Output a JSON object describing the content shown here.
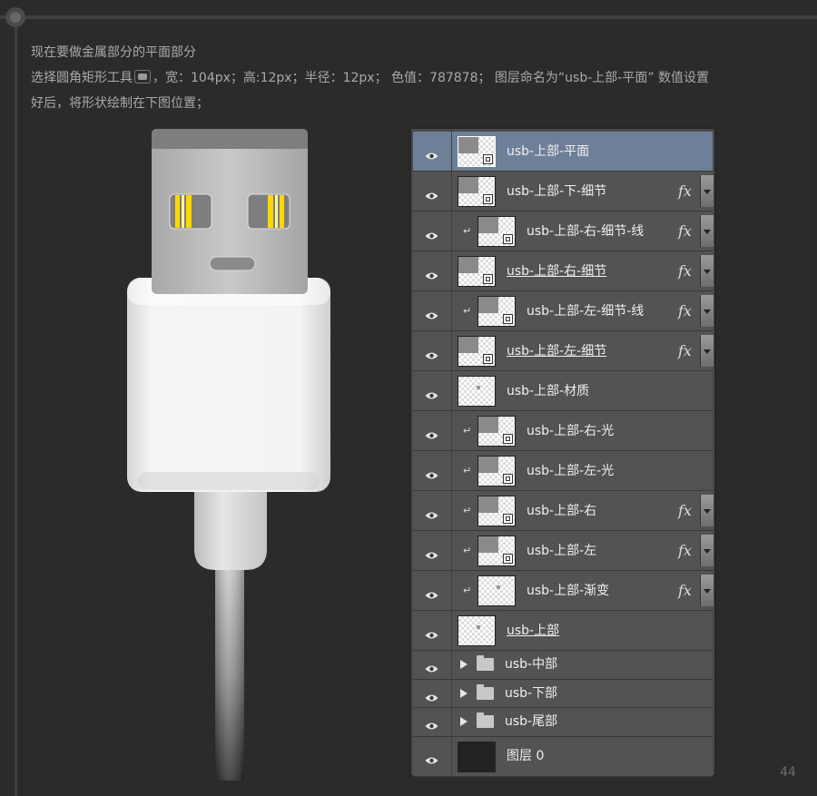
{
  "instructions": {
    "line1": "现在要做金属部分的平面部分",
    "line2_before_icon": "选择圆角矩形工具",
    "line2_after_icon": "，宽：104px；高:12px；半径：12px； 色值：787878； 图层命名为“usb-上部-平面” 数值设置",
    "line3": "好后，将形状绘制在下图位置；",
    "tool_icon": "rounded-rectangle-tool-icon"
  },
  "layers": [
    {
      "name": "usb-上部-平面",
      "selected": true,
      "clipped": false,
      "fx": false,
      "underline": false,
      "thumb": "shape"
    },
    {
      "name": "usb-上部-下-细节",
      "selected": false,
      "clipped": false,
      "fx": true,
      "underline": false,
      "thumb": "shape"
    },
    {
      "name": "usb-上部-右-细节-线",
      "selected": false,
      "clipped": true,
      "fx": true,
      "underline": false,
      "thumb": "shape"
    },
    {
      "name": "usb-上部-右-细节",
      "selected": false,
      "clipped": false,
      "fx": true,
      "underline": true,
      "thumb": "shape"
    },
    {
      "name": "usb-上部-左-细节-线",
      "selected": false,
      "clipped": true,
      "fx": true,
      "underline": false,
      "thumb": "shape"
    },
    {
      "name": "usb-上部-左-细节",
      "selected": false,
      "clipped": false,
      "fx": true,
      "underline": true,
      "thumb": "shape"
    },
    {
      "name": "usb-上部-材质",
      "selected": false,
      "clipped": false,
      "fx": false,
      "underline": false,
      "thumb": "pixel"
    },
    {
      "name": "usb-上部-右-光",
      "selected": false,
      "clipped": true,
      "fx": false,
      "underline": false,
      "thumb": "shape"
    },
    {
      "name": "usb-上部-左-光",
      "selected": false,
      "clipped": true,
      "fx": false,
      "underline": false,
      "thumb": "shape"
    },
    {
      "name": "usb-上部-右",
      "selected": false,
      "clipped": true,
      "fx": true,
      "underline": false,
      "thumb": "shape"
    },
    {
      "name": "usb-上部-左",
      "selected": false,
      "clipped": true,
      "fx": true,
      "underline": false,
      "thumb": "shape"
    },
    {
      "name": "usb-上部-渐变",
      "selected": false,
      "clipped": true,
      "fx": true,
      "underline": false,
      "thumb": "pixel"
    },
    {
      "name": "usb-上部",
      "selected": false,
      "clipped": false,
      "fx": false,
      "underline": true,
      "thumb": "pixel"
    }
  ],
  "groups": [
    {
      "name": "usb-中部"
    },
    {
      "name": "usb-下部"
    },
    {
      "name": "usb-尾部"
    }
  ],
  "background_layer": {
    "name": "图层 0"
  },
  "icons": {
    "visibility": "eye-icon",
    "effects": "fx-icon",
    "clip": "clipping-mask-icon",
    "group": "folder-icon"
  },
  "fx_label": "fx",
  "clip_glyph": "↵",
  "page_number": "44",
  "colors": {
    "selected_row": "#6e7f98",
    "row": "#535353",
    "background": "#2b2b2b"
  }
}
